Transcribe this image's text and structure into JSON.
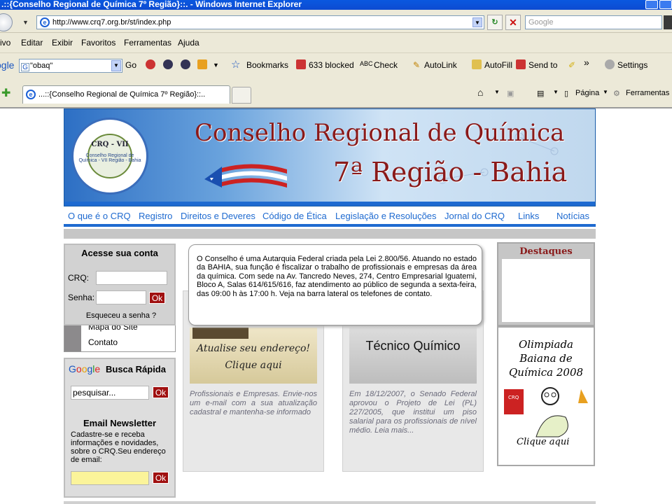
{
  "window": {
    "title": ".::{Conselho Regional de Química 7º Região}::. - Windows Internet Explorer"
  },
  "address": {
    "url": "http://www.crq7.org.br/st/index.php",
    "search_placeholder": "Google"
  },
  "menu": [
    "ivo",
    "Editar",
    "Exibir",
    "Favoritos",
    "Ferramentas",
    "Ajuda"
  ],
  "toolbar": {
    "google": "ogle",
    "search_value": "\"obaq\"",
    "go": "Go",
    "bookmarks": "Bookmarks",
    "blocked": "633 blocked",
    "check": "Check",
    "autolink": "AutoLink",
    "autofill": "AutoFill",
    "sendto": "Send to",
    "more": "»",
    "settings": "Settings"
  },
  "tabs": {
    "active": "...::{Conselho Regional de Química 7º Região}::..",
    "pagina": "Página",
    "ferramentas": "Ferramentas"
  },
  "banner": {
    "seal_text": "CRQ - VII",
    "seal_ring": "Conselho Regional de Química - VII Região - Bahia",
    "title_line1": "Conselho Regional de Química",
    "title_line2": "7ª Região - Bahia"
  },
  "nav": [
    "O que é o CRQ",
    "Registro",
    "Direitos e Deveres",
    "Código de Ética",
    "Legislação e Resoluções",
    "Jornal do CRQ",
    "Links",
    "Notícias"
  ],
  "login": {
    "title": "Acesse sua conta",
    "crq_label": "CRQ:",
    "senha_label": "Senha:",
    "ok": "Ok",
    "forgot": "Esqueceu a senha ?"
  },
  "side_menu": [
    "Mapa do Site",
    "Contato"
  ],
  "busca": {
    "logo": "Google",
    "title": "Busca Rápida",
    "input_value": "pesquisar...",
    "ok": "Ok",
    "newsletter_title": "Email Newsletter",
    "newsletter_text": "Cadastre-se e receba informações e novidades, sobre o CRQ.Seu endereço de email:",
    "newsletter_ok": "Ok"
  },
  "tooltip": "O Conselho é uma Autarquia Federal criada pela Lei 2.800/56. Atuando no estado da BAHIA, sua função é fiscalizar o trabalho de profissionais e empresas da área da química. Com sede na Av. Tancredo Neves, 274, Centro Empresarial Iguatemi, Bloco A, Salas 614/615/616, faz atendimento ao público de segunda a sexta-feira, das 09:00 h às 17:00 h. Veja na barra lateral os telefones de contato.",
  "panels": [
    {
      "image_text1": "Atualise seu endereço!",
      "image_text2": "Clique aqui",
      "text": "Profissionais e Empresas. Envie-nos um e-mail com a sua atualização cadastral e mantenha-se informado"
    },
    {
      "image_text": "Técnico Químico",
      "text": "Em 18/12/2007, o Senado Federal aprovou o Projeto de Lei (PL) 227/2005, que institui um piso salarial para os profissionais de nível médio. Leia mais..."
    }
  ],
  "destaques": {
    "title": "Destaques"
  },
  "olimpiada": {
    "title": "Olimpiada Baiana de Química 2008",
    "book_label": "CRQ",
    "click": "Clique aqui"
  }
}
